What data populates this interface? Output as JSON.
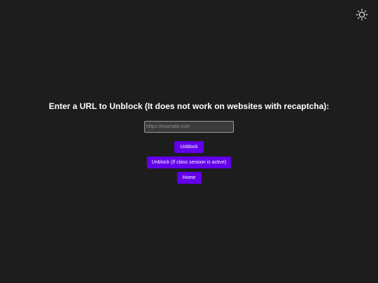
{
  "header": {
    "theme_toggle_icon": "sun-icon"
  },
  "main": {
    "heading": "Enter a URL to Unblock (It does not work on websites with recaptcha):",
    "url_input": {
      "placeholder": "https://example.com",
      "value": ""
    },
    "buttons": {
      "unblock": "Unblock",
      "unblock_class": "Unblock (If class session is active)",
      "home": "Home"
    }
  },
  "colors": {
    "background": "#1e1d1e",
    "accent": "#6200ea",
    "text": "#ffffff"
  }
}
